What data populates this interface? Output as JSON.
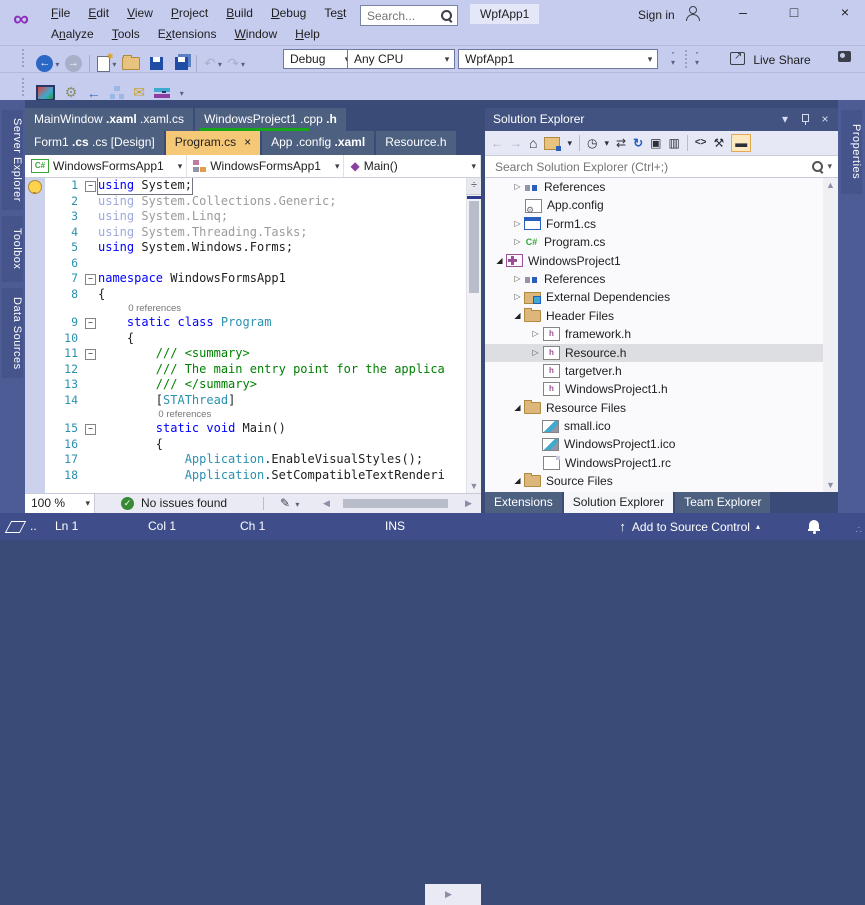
{
  "titlebar": {
    "search_placeholder": "Search...",
    "project_badge": "WpfApp1",
    "sign_in": "Sign in"
  },
  "menu": {
    "row1": [
      {
        "label": "File",
        "u": 0
      },
      {
        "label": "Edit",
        "u": 0
      },
      {
        "label": "View",
        "u": 0
      },
      {
        "label": "Project",
        "u": 0
      },
      {
        "label": "Build",
        "u": 0
      },
      {
        "label": "Debug",
        "u": 0
      },
      {
        "label": "Test",
        "u": 2
      }
    ],
    "row2": [
      {
        "label": "Analyze",
        "u": 1
      },
      {
        "label": "Tools",
        "u": 0
      },
      {
        "label": "Extensions",
        "u": 1
      },
      {
        "label": "Window",
        "u": 0
      },
      {
        "label": "Help",
        "u": 0
      }
    ]
  },
  "toolbar": {
    "debug_target": "Debug",
    "platform": "Any CPU",
    "startup_project": "WpfApp1",
    "live_share": "Live Share"
  },
  "left_tool_tabs": [
    "Server Explorer",
    "Toolbox",
    "Data Sources"
  ],
  "right_tool_tabs": [
    "Properties"
  ],
  "editor": {
    "tab_row1": [
      {
        "parts": [
          {
            "t": "MainWindow ",
            "b": false
          },
          {
            "t": ".xaml",
            "b": true
          },
          {
            "t": " .xaml.cs",
            "b": false
          }
        ]
      },
      {
        "parts": [
          {
            "t": "WindowsProject1 ",
            "b": false
          },
          {
            "t": ".cpp",
            "b": false
          },
          {
            "t": " ",
            "b": false
          },
          {
            "t": ".h",
            "b": true
          }
        ],
        "underline": true
      }
    ],
    "tab_row2": [
      {
        "parts": [
          {
            "t": "Form1 ",
            "b": false
          },
          {
            "t": ".cs",
            "b": true
          },
          {
            "t": " .cs [Design]",
            "b": false
          }
        ]
      },
      {
        "parts": [
          {
            "t": "Program.cs",
            "b": false
          }
        ],
        "active": true,
        "close": true
      },
      {
        "parts": [
          {
            "t": "App ",
            "b": false
          },
          {
            "t": ".config",
            "b": false
          },
          {
            "t": " ",
            "b": false
          },
          {
            "t": ".xaml",
            "b": true
          }
        ]
      },
      {
        "parts": [
          {
            "t": "Resource.h",
            "b": false
          }
        ]
      }
    ],
    "breadcrumb": [
      {
        "icon": "csharp",
        "label": "WindowsFormsApp1"
      },
      {
        "icon": "class",
        "label": "WindowsFormsApp1"
      },
      {
        "icon": "method",
        "label": "Main()"
      }
    ],
    "code": {
      "lines": [
        {
          "t": "code",
          "n": "1",
          "fold": true,
          "bulb": true,
          "box": true,
          "seg": [
            [
              "using",
              "kw"
            ],
            [
              " System;",
              "pl"
            ]
          ]
        },
        {
          "t": "code",
          "n": "2",
          "seg": [
            [
              "using",
              "kwdim"
            ],
            [
              " System.Collections.Generic;",
              "dim"
            ]
          ]
        },
        {
          "t": "code",
          "n": "3",
          "seg": [
            [
              "using",
              "kwdim"
            ],
            [
              " System.Linq;",
              "dim"
            ]
          ]
        },
        {
          "t": "code",
          "n": "4",
          "seg": [
            [
              "using",
              "kwdim"
            ],
            [
              " System.Threading.Tasks;",
              "dim"
            ]
          ]
        },
        {
          "t": "code",
          "n": "5",
          "seg": [
            [
              "using",
              "kw"
            ],
            [
              " System.Windows.Forms;",
              "pl"
            ]
          ]
        },
        {
          "t": "code",
          "n": "6",
          "seg": []
        },
        {
          "t": "code",
          "n": "7",
          "fold": true,
          "seg": [
            [
              "namespace",
              "kw"
            ],
            [
              " WindowsFormsApp1",
              "pl"
            ]
          ]
        },
        {
          "t": "code",
          "n": "8",
          "seg": [
            [
              "{",
              "pl"
            ]
          ]
        },
        {
          "t": "lens",
          "pad": 4,
          "text": "0 references"
        },
        {
          "t": "code",
          "n": "9",
          "fold": true,
          "seg": [
            [
              "    ",
              "pl"
            ],
            [
              "static",
              "kw"
            ],
            [
              " ",
              "pl"
            ],
            [
              "class",
              "kw"
            ],
            [
              " ",
              "pl"
            ],
            [
              "Program",
              "ty"
            ]
          ]
        },
        {
          "t": "code",
          "n": "10",
          "seg": [
            [
              "    {",
              "pl"
            ]
          ]
        },
        {
          "t": "code",
          "n": "11",
          "fold": true,
          "seg": [
            [
              "        ",
              "pl"
            ],
            [
              "/// <summary>",
              "cm"
            ]
          ]
        },
        {
          "t": "code",
          "n": "12",
          "seg": [
            [
              "        ",
              "pl"
            ],
            [
              "/// The main entry point for the applica",
              "cm"
            ]
          ]
        },
        {
          "t": "code",
          "n": "13",
          "seg": [
            [
              "        ",
              "pl"
            ],
            [
              "/// </summary>",
              "cm"
            ]
          ]
        },
        {
          "t": "code",
          "n": "14",
          "seg": [
            [
              "        [",
              "pl"
            ],
            [
              "STAThread",
              "ty"
            ],
            [
              "]",
              "pl"
            ]
          ]
        },
        {
          "t": "lens",
          "pad": 8,
          "text": "0 references"
        },
        {
          "t": "code",
          "n": "15",
          "fold": true,
          "seg": [
            [
              "        ",
              "pl"
            ],
            [
              "static",
              "kw"
            ],
            [
              " ",
              "pl"
            ],
            [
              "void",
              "kw"
            ],
            [
              " Main()",
              "pl"
            ]
          ]
        },
        {
          "t": "code",
          "n": "16",
          "seg": [
            [
              "        {",
              "pl"
            ]
          ]
        },
        {
          "t": "code",
          "n": "17",
          "seg": [
            [
              "            ",
              "pl"
            ],
            [
              "Application",
              "ty"
            ],
            [
              ".EnableVisualStyles();",
              "pl"
            ]
          ]
        },
        {
          "t": "code",
          "n": "18",
          "seg": [
            [
              "            ",
              "pl"
            ],
            [
              "Application",
              "ty"
            ],
            [
              ".SetCompatibleTextRenderi",
              "pl"
            ]
          ]
        }
      ]
    },
    "zoom": "100 %",
    "health": "No issues found"
  },
  "solution_explorer": {
    "title": "Solution Explorer",
    "search_placeholder": "Search Solution Explorer (Ctrl+;)",
    "tree": [
      {
        "level": 1,
        "arrow": "right",
        "icon": "ti-ref",
        "label": "References"
      },
      {
        "level": 1,
        "arrow": "none",
        "icon": "ti-appcfg",
        "label": "App.config"
      },
      {
        "level": 1,
        "arrow": "right",
        "icon": "ti-form",
        "label": "Form1.cs"
      },
      {
        "level": 1,
        "arrow": "right",
        "icon": "ti-cs",
        "label": "Program.cs"
      },
      {
        "level": 0,
        "arrow": "down",
        "icon": "ti-cpp",
        "label": "WindowsProject1"
      },
      {
        "level": 1,
        "arrow": "right",
        "icon": "ti-ref",
        "label": "References"
      },
      {
        "level": 1,
        "arrow": "right",
        "icon": "ti-extdep",
        "label": "External Dependencies"
      },
      {
        "level": 1,
        "arrow": "down",
        "icon": "ti-folder",
        "label": "Header Files"
      },
      {
        "level": 2,
        "arrow": "right",
        "icon": "ti-h",
        "label": "framework.h"
      },
      {
        "level": 2,
        "arrow": "right",
        "icon": "ti-h",
        "label": "Resource.h",
        "selected": true
      },
      {
        "level": 2,
        "arrow": "none",
        "icon": "ti-h",
        "label": "targetver.h"
      },
      {
        "level": 2,
        "arrow": "none",
        "icon": "ti-h",
        "label": "WindowsProject1.h"
      },
      {
        "level": 1,
        "arrow": "down",
        "icon": "ti-folder",
        "label": "Resource Files"
      },
      {
        "level": 2,
        "arrow": "none",
        "icon": "ti-img",
        "label": "small.ico"
      },
      {
        "level": 2,
        "arrow": "none",
        "icon": "ti-img",
        "label": "WindowsProject1.ico"
      },
      {
        "level": 2,
        "arrow": "none",
        "icon": "ti-rc",
        "label": "WindowsProject1.rc"
      },
      {
        "level": 1,
        "arrow": "down",
        "icon": "ti-folder",
        "label": "Source Files"
      }
    ],
    "bottom_tabs": [
      {
        "label": "Extensions",
        "active": false
      },
      {
        "label": "Solution Explorer",
        "active": true
      },
      {
        "label": "Team Explorer",
        "active": false
      }
    ]
  },
  "status_bar": {
    "overflow_dots": "..",
    "left": [
      "Ln 1",
      "Col 1",
      "Ch 1",
      "INS"
    ],
    "source_control": "Add to Source Control"
  },
  "icons": {
    "back": "←",
    "forward": "→",
    "home": "⌂",
    "dropdown": "▾",
    "undo": "↶",
    "redo": "↷",
    "sync": "⇄",
    "refresh": "↻",
    "clock": "◷",
    "collapse_all": "▣",
    "show_all_files": "▥",
    "view_code": "<>",
    "properties_tool": "⚒",
    "preview": "▬",
    "close": "×",
    "minimize": "–",
    "maximize": "□",
    "gears": "⚙",
    "mail": "✉",
    "back_nav": "←",
    "scroll_up": "▲",
    "scroll_down": "▼",
    "scroll_left": "◀",
    "scroll_right": "▶",
    "splitter": "÷",
    "check": "✓",
    "cleanup": "✎",
    "caret_up": "▴",
    "up_arrow": "↑",
    "fold_minus": "−",
    "grip_dots": "∴"
  },
  "colors": {
    "chrome": "#c6ccee",
    "env": "#394b76",
    "tab_inactive": "#4d6080",
    "tab_active": "#f5c877",
    "git_underline": "#17a817",
    "status_bg": "#3f4e8a"
  }
}
